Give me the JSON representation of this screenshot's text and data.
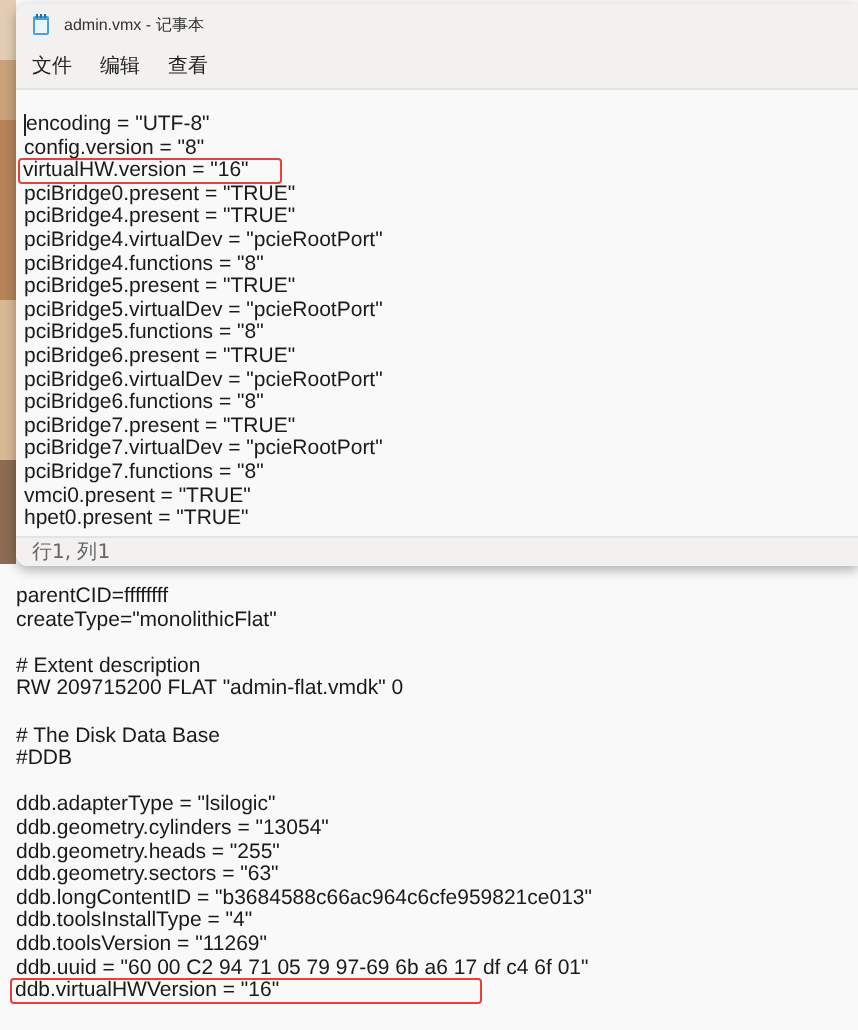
{
  "window": {
    "title": "admin.vmx - 记事本"
  },
  "menu": [
    "文件",
    "编辑",
    "查看"
  ],
  "editor": {
    "cursor_at_start": true,
    "lines": [
      {
        "text": "encoding = \"UTF-8\"",
        "highlighted": false
      },
      {
        "text": "config.version = \"8\"",
        "highlighted": false
      },
      {
        "text": "virtualHW.version = \"16\"",
        "highlighted": true
      },
      {
        "text": "pciBridge0.present = \"TRUE\"",
        "highlighted": false
      },
      {
        "text": "pciBridge4.present = \"TRUE\"",
        "highlighted": false
      },
      {
        "text": "pciBridge4.virtualDev = \"pcieRootPort\"",
        "highlighted": false
      },
      {
        "text": "pciBridge4.functions = \"8\"",
        "highlighted": false
      },
      {
        "text": "pciBridge5.present = \"TRUE\"",
        "highlighted": false
      },
      {
        "text": "pciBridge5.virtualDev = \"pcieRootPort\"",
        "highlighted": false
      },
      {
        "text": "pciBridge5.functions = \"8\"",
        "highlighted": false
      },
      {
        "text": "pciBridge6.present = \"TRUE\"",
        "highlighted": false
      },
      {
        "text": "pciBridge6.virtualDev = \"pcieRootPort\"",
        "highlighted": false
      },
      {
        "text": "pciBridge6.functions = \"8\"",
        "highlighted": false
      },
      {
        "text": "pciBridge7.present = \"TRUE\"",
        "highlighted": false
      },
      {
        "text": "pciBridge7.virtualDev = \"pcieRootPort\"",
        "highlighted": false
      },
      {
        "text": "pciBridge7.functions = \"8\"",
        "highlighted": false
      },
      {
        "text": "vmci0.present = \"TRUE\"",
        "highlighted": false
      },
      {
        "text": "hpet0.present = \"TRUE\"",
        "highlighted": false
      }
    ]
  },
  "status_bar": "行1, 列1",
  "second_document": {
    "blocks": [
      [
        {
          "text": "parentCID=ffffffff",
          "highlighted": false
        },
        {
          "text": "createType=\"monolithicFlat\"",
          "highlighted": false
        }
      ],
      [
        {
          "text": "# Extent description",
          "highlighted": false
        },
        {
          "text": "RW 209715200 FLAT \"admin-flat.vmdk\" 0",
          "highlighted": false
        }
      ],
      [
        {
          "text": "# The Disk Data Base",
          "highlighted": false
        },
        {
          "text": "#DDB",
          "highlighted": false
        }
      ],
      [
        {
          "text": "ddb.adapterType = \"lsilogic\"",
          "highlighted": false
        },
        {
          "text": "ddb.geometry.cylinders = \"13054\"",
          "highlighted": false
        },
        {
          "text": "ddb.geometry.heads = \"255\"",
          "highlighted": false
        },
        {
          "text": "ddb.geometry.sectors = \"63\"",
          "highlighted": false
        },
        {
          "text": "ddb.longContentID = \"b3684588c66ac964c6cfe959821ce013\"",
          "highlighted": false
        },
        {
          "text": "ddb.toolsInstallType = \"4\"",
          "highlighted": false
        },
        {
          "text": "ddb.toolsVersion = \"11269\"",
          "highlighted": false
        },
        {
          "text": "ddb.uuid = \"60 00 C2 94 71 05 79 97-69 6b a6 17 df c4 6f 01\"",
          "highlighted": false
        },
        {
          "text": "ddb.virtualHWVersion = \"16\"",
          "highlighted": true
        }
      ]
    ]
  }
}
